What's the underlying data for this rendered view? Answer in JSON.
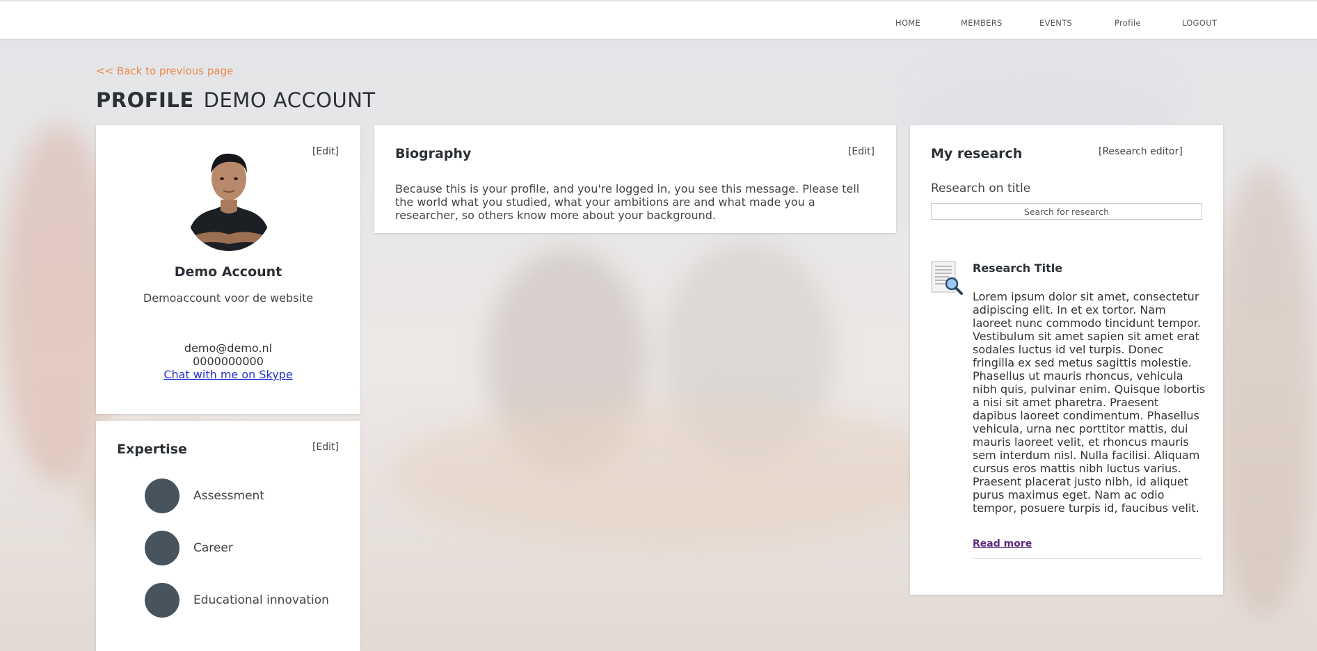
{
  "nav": {
    "items": [
      {
        "label": "HOME"
      },
      {
        "label": "MEMBERS"
      },
      {
        "label": "EVENTS"
      },
      {
        "label": "Profile"
      },
      {
        "label": "LOGOUT"
      }
    ]
  },
  "back_link": "<< Back to previous page",
  "page_title": {
    "prefix": "PROFILE",
    "name": "DEMO ACCOUNT"
  },
  "profile_card": {
    "edit": "[Edit]",
    "name": "Demo Account",
    "subtitle": "Demoaccount voor de website",
    "email": "demo@demo.nl",
    "phone": "0000000000",
    "skype": "Chat with me on Skype"
  },
  "expertise": {
    "title": "Expertise",
    "edit": "[Edit]",
    "items": [
      {
        "label": "Assessment"
      },
      {
        "label": "Career"
      },
      {
        "label": "Educational innovation"
      }
    ]
  },
  "biography": {
    "title": "Biography",
    "edit": "[Edit]",
    "text": "Because this is your profile, and you're logged in, you see this message. Please tell the world what you studied, what your ambitions are and what made you a researcher, so others know more about your background."
  },
  "research": {
    "title": "My research",
    "editor": "[Research editor]",
    "search_label": "Research on title",
    "search_placeholder": "Search for research",
    "item": {
      "title": "Research Title",
      "body": "Lorem ipsum dolor sit amet, consectetur adipiscing elit. In et ex tortor. Nam laoreet nunc commodo tincidunt tempor. Vestibulum sit amet sapien sit amet erat sodales luctus id vel turpis. Donec fringilla ex sed metus sagittis molestie. Phasellus ut mauris rhoncus, vehicula nibh quis, pulvinar enim. Quisque lobortis a nisi sit amet pharetra. Praesent dapibus laoreet condimentum. Phasellus vehicula, urna nec porttitor mattis, dui mauris laoreet velit, et rhoncus mauris sem interdum nisl. Nulla facilisi. Aliquam cursus eros mattis nibh luctus varius. Praesent placerat justo nibh, id aliquet purus maximus eget. Nam ac odio tempor, posuere turpis id, faucibus velit.",
      "read_more": "Read more"
    }
  },
  "colors": {
    "accent": "#e8874a",
    "expertise_circle": "#47545d",
    "link": "#2233cc"
  }
}
